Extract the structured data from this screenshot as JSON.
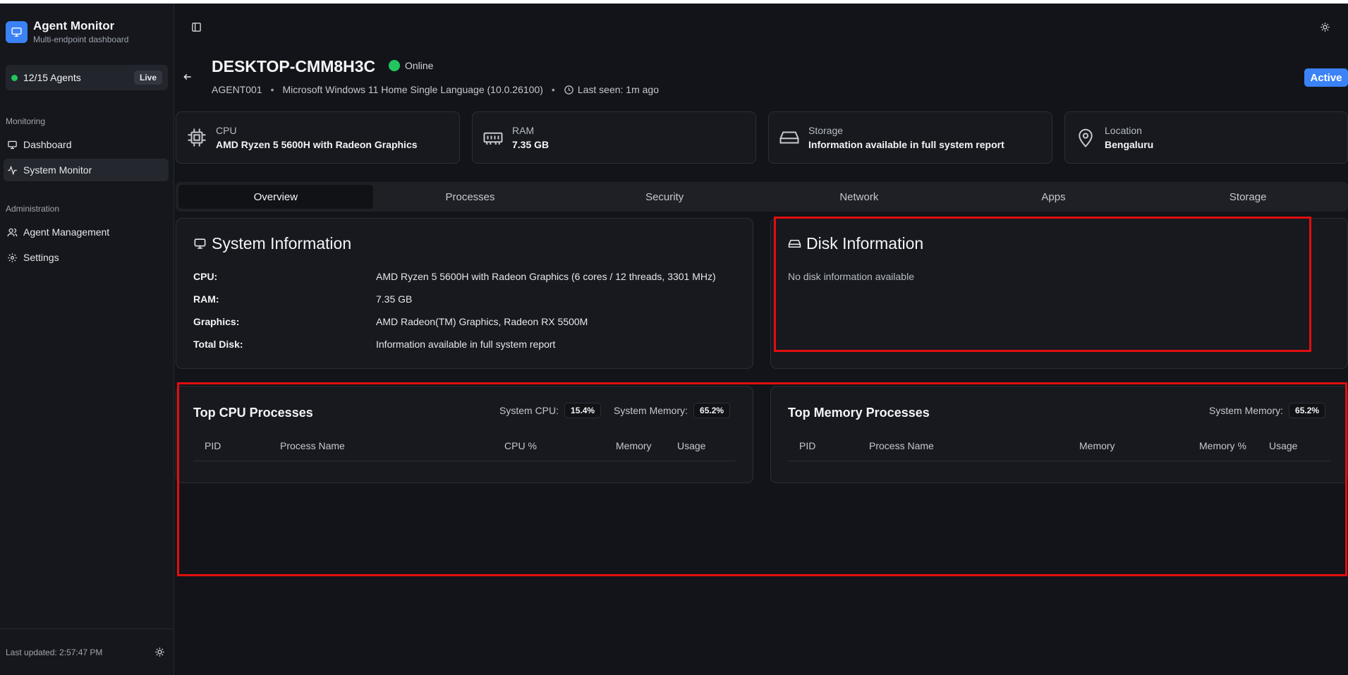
{
  "sidebar": {
    "brand_title": "Agent Monitor",
    "brand_subtitle": "Multi-endpoint dashboard",
    "agents_count": "12/15 Agents",
    "live_label": "Live",
    "sections": [
      {
        "label": "Monitoring",
        "items": [
          {
            "label": "Dashboard",
            "icon": "monitor-icon"
          },
          {
            "label": "System Monitor",
            "icon": "activity-icon",
            "active": true
          }
        ]
      },
      {
        "label": "Administration",
        "items": [
          {
            "label": "Agent Management",
            "icon": "users-icon"
          },
          {
            "label": "Settings",
            "icon": "gear-icon"
          }
        ]
      }
    ],
    "last_updated": "Last updated: 2:57:47 PM"
  },
  "header": {
    "hostname": "DESKTOP-CMM8H3C",
    "status": "Online",
    "agent_id": "AGENT001",
    "os": "Microsoft Windows 11 Home Single Language (10.0.26100)",
    "last_seen": "Last seen: 1m ago",
    "badge": "Active"
  },
  "cards": [
    {
      "label": "CPU",
      "value": "AMD Ryzen 5 5600H with Radeon Graphics",
      "icon": "cpu-icon"
    },
    {
      "label": "RAM",
      "value": "7.35 GB",
      "icon": "memory-icon"
    },
    {
      "label": "Storage",
      "value": "Information available in full system report",
      "icon": "hard-drive-icon"
    },
    {
      "label": "Location",
      "value": "Bengaluru",
      "icon": "map-pin-icon"
    }
  ],
  "tabs": [
    "Overview",
    "Processes",
    "Security",
    "Network",
    "Apps",
    "Storage"
  ],
  "active_tab": "Overview",
  "system_info": {
    "title": "System Information",
    "rows": [
      {
        "label": "CPU:",
        "value": "AMD Ryzen 5 5600H with Radeon Graphics (6 cores / 12 threads, 3301 MHz)"
      },
      {
        "label": "RAM:",
        "value": "7.35 GB"
      },
      {
        "label": "Graphics:",
        "value": "AMD Radeon(TM) Graphics, Radeon RX 5500M"
      },
      {
        "label": "Total Disk:",
        "value": "Information available in full system report"
      }
    ]
  },
  "disk_info": {
    "title": "Disk Information",
    "empty_text": "No disk information available"
  },
  "top_cpu": {
    "title": "Top CPU Processes",
    "system_cpu_label": "System CPU:",
    "system_cpu_value": "15.4%",
    "system_memory_label": "System Memory:",
    "system_memory_value": "65.2%",
    "columns": [
      "PID",
      "Process Name",
      "CPU %",
      "Memory",
      "Usage"
    ]
  },
  "top_memory": {
    "title": "Top Memory Processes",
    "system_memory_label": "System Memory:",
    "system_memory_value": "65.2%",
    "columns": [
      "PID",
      "Process Name",
      "Memory",
      "Memory %",
      "Usage"
    ]
  },
  "colors": {
    "accent": "#3b82f6",
    "online": "#22c55e",
    "highlight": "#e10e0e",
    "background": "#131419"
  }
}
